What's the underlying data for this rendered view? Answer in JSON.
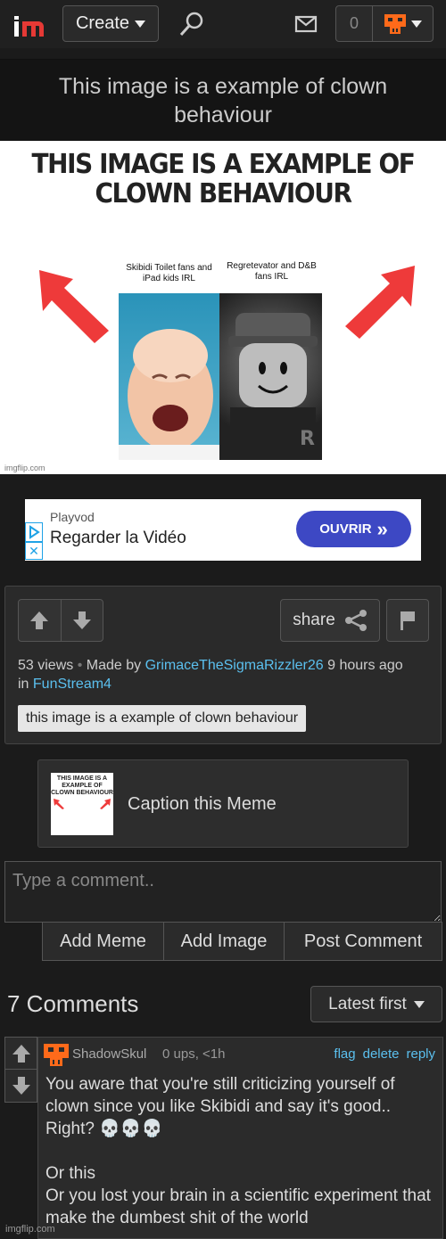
{
  "header": {
    "logo_text": "im",
    "create_label": "Create",
    "notif_count": "0"
  },
  "meme": {
    "title": "This image is a example of clown behaviour",
    "caption": "THIS IMAGE IS A EXAMPLE OF CLOWN BEHAVIOUR",
    "left_label": "Skibidi Toilet fans and iPad kids IRL",
    "right_label": "Regretevator and D&B fans IRL",
    "watermark": "imgflip.com"
  },
  "ad": {
    "brand": "Playvod",
    "headline": "Regarder la Vidéo",
    "cta": "OUVRIR",
    "cta_arrows": "»"
  },
  "info": {
    "share_label": "share",
    "views": "53 views",
    "made_by_prefix": "Made by",
    "author": "GrimaceTheSigmaRizzler26",
    "time": "9 hours ago",
    "in_prefix": "in",
    "stream": "FunStream4",
    "tag": "this image is a example of clown behaviour"
  },
  "caption_box": {
    "thumb_text": "THIS IMAGE IS A EXAMPLE OF CLOWN BEHAVIOUR",
    "label": "Caption this Meme"
  },
  "comment_form": {
    "placeholder": "Type a comment..",
    "buttons": [
      "Add Meme",
      "Add Image",
      "Post Comment"
    ]
  },
  "comments_header": {
    "count_label": "7 Comments",
    "sort_label": "Latest first"
  },
  "comments": [
    {
      "author": "ShadowSkul",
      "meta": "0 ups, <1h",
      "actions": [
        "flag",
        "delete",
        "reply"
      ],
      "text": "You aware that you're still criticizing yourself of clown since you like Skibidi and say it's good.. Right? 💀💀💀\n\nOr this\nOr you lost your brain in a scientific experiment that make the dumbest shit of the world"
    }
  ],
  "footer": {
    "watermark": "imgflip.com"
  },
  "colors": {
    "link": "#5bc0ef",
    "accent": "#ff5a1f",
    "ad_cta": "#3d48c4"
  }
}
